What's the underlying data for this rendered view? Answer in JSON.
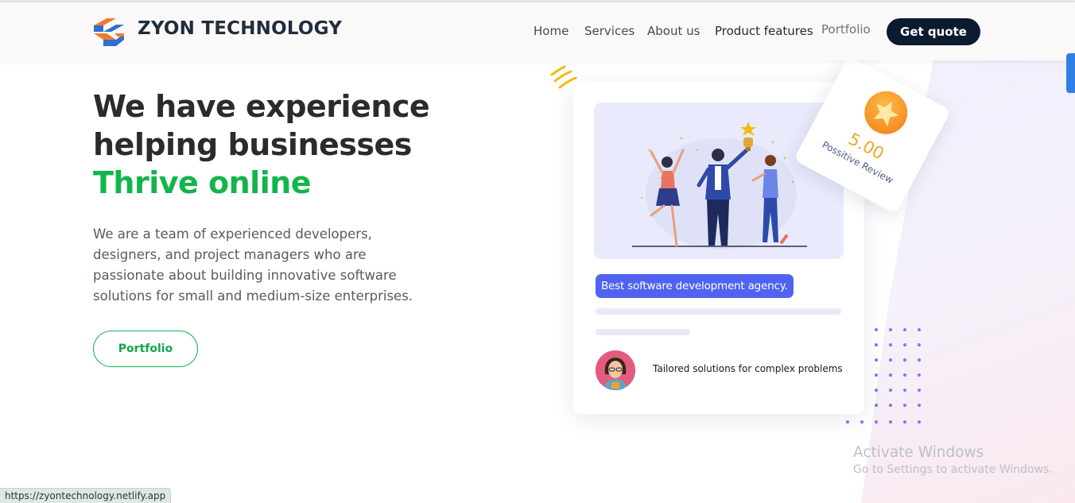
{
  "brand": {
    "name": "ZYON TECHNOLOGY",
    "logo_icon": "stacked-chevron-logo"
  },
  "nav": {
    "items": [
      {
        "label": "Home"
      },
      {
        "label": "Services"
      },
      {
        "label": "About us"
      },
      {
        "label": "Product features"
      },
      {
        "label": "Portfolio"
      }
    ],
    "cta_label": "Get quote"
  },
  "hero": {
    "title_line1": "We have experience",
    "title_line2": "helping businesses",
    "title_accent": "Thrive online",
    "description": "We are a team of experienced developers, designers, and project managers who are passionate about building innovative software solutions for small and medium-size enterprises.",
    "button_label": "Portfolio"
  },
  "card": {
    "illustration_icon": "team-celebrating-trophy-illustration",
    "pill_text": "Best software development agency.",
    "tagline": "Tailored solutions for complex problems",
    "avatar_icon": "woman-avatar"
  },
  "review": {
    "score": "5.00",
    "label": "Possitive Review",
    "icon": "star-icon"
  },
  "os_overlay": {
    "title": "Activate Windows",
    "subtitle": "Go to Settings to activate Windows."
  },
  "status_url": "https://zyontechnology.netlify.app",
  "colors": {
    "accent_green": "#13b54b",
    "cta_dark": "#0b1a2e",
    "pill_blue": "#4f63f0",
    "review_gold": "#f5a623"
  }
}
